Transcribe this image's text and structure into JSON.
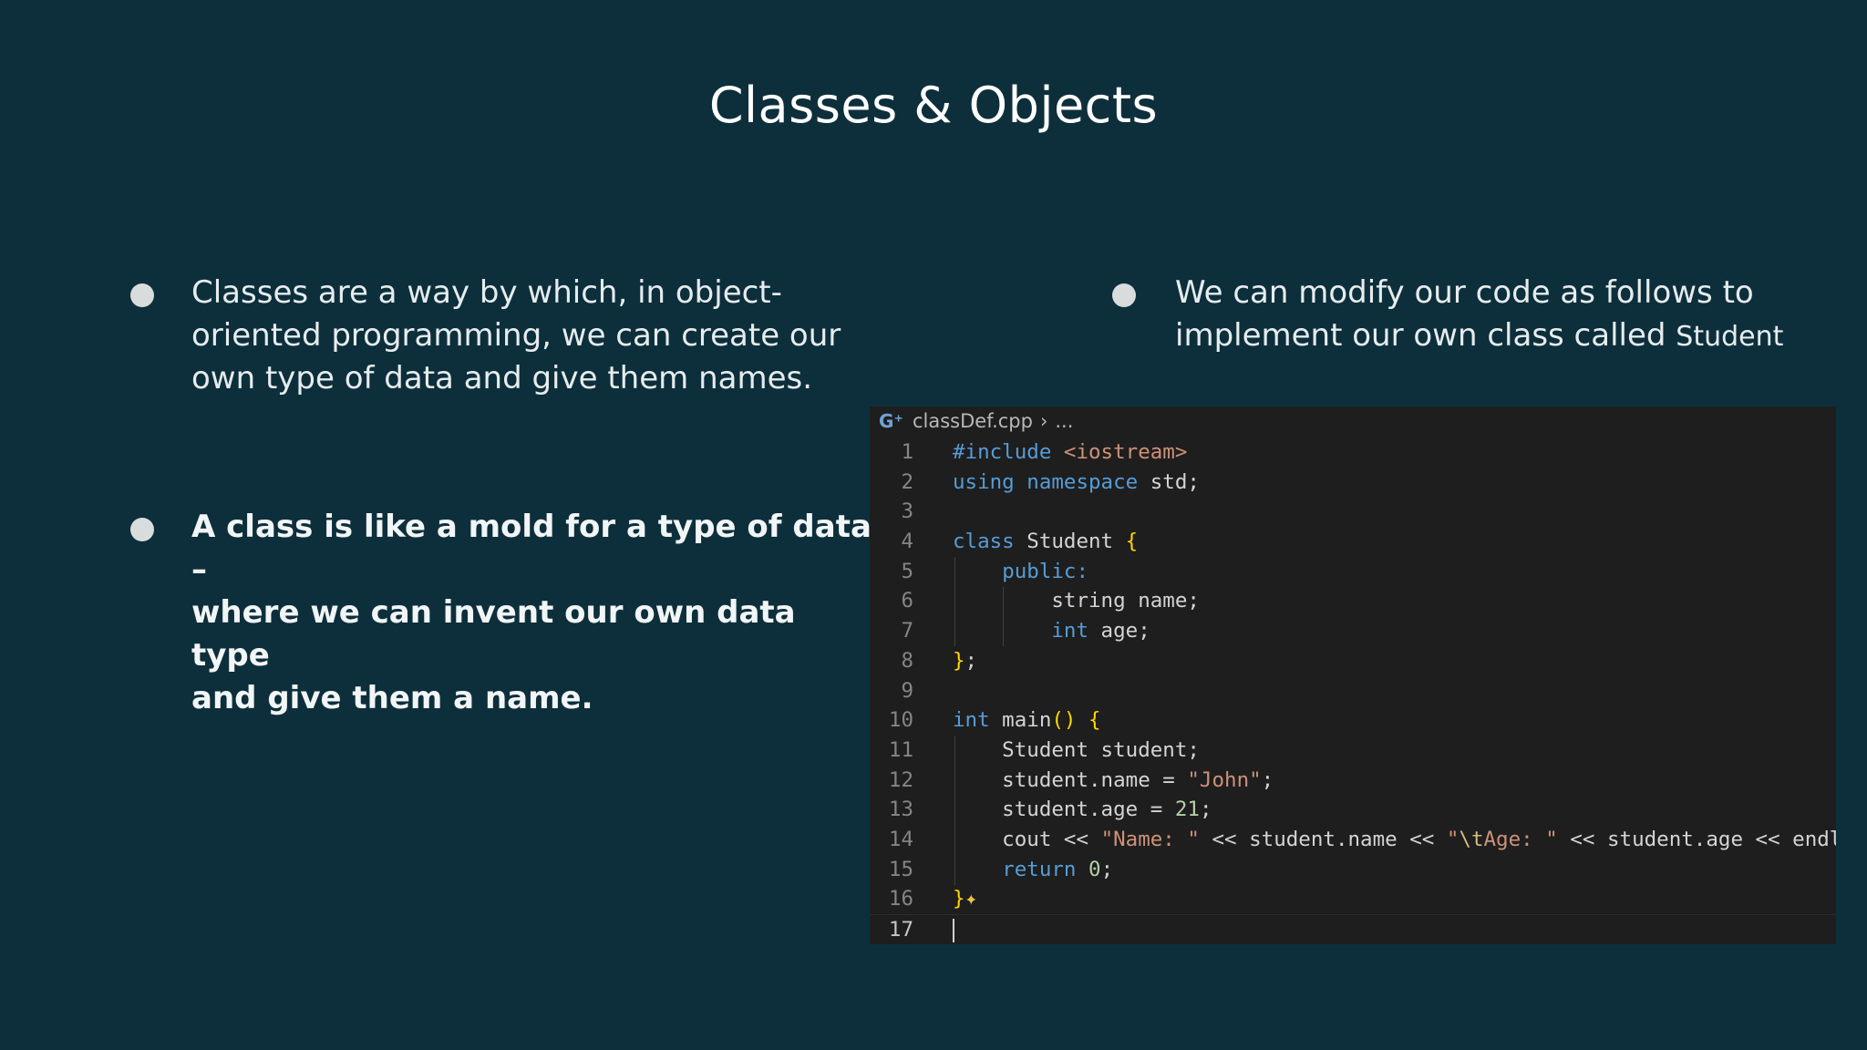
{
  "slide": {
    "title": "Classes & Objects",
    "left": {
      "bullet1_lines": [
        "Classes are a way by which, in object-",
        "oriented programming, we can create our",
        "own type of data and give them names."
      ],
      "bullet2_lines": [
        "A class is like a mold for a type of data –",
        "where we can invent our own data type",
        "and give them a name."
      ]
    },
    "right": {
      "bullet_line1": "We can modify our code as follows to",
      "bullet_line2_prefix": "implement our own class called ",
      "bullet_line2_code": "Student"
    }
  },
  "editor": {
    "file_name": "classDef.cpp",
    "breadcrumb_more": "...",
    "line_numbers": [
      "1",
      "2",
      "3",
      "4",
      "5",
      "6",
      "7",
      "8",
      "9",
      "10",
      "11",
      "12",
      "13",
      "14",
      "15",
      "16",
      "17"
    ],
    "lines": [
      "#include <iostream>",
      "using namespace std;",
      "",
      "class Student {",
      "    public:",
      "        string name;",
      "        int age;",
      "};",
      "",
      "int main() {",
      "    Student student;",
      "    student.name = \"John\";",
      "    student.age = 21;",
      "    cout << \"Name: \" << student.name << \"\\tAge: \" << student.age << endl;",
      "    return 0;",
      "}",
      ""
    ],
    "active_line": 17
  },
  "colors": {
    "background": "#0d2f3b",
    "editor_background": "#1e1e1e",
    "keyword": "#569cd6",
    "string": "#ce9178",
    "bracket": "#ffd700"
  }
}
